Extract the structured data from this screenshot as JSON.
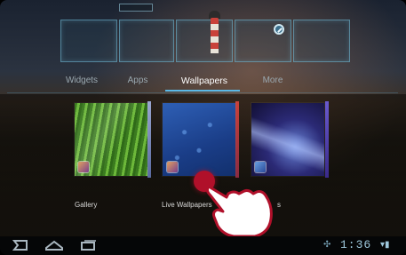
{
  "tabs": [
    {
      "label": "Widgets",
      "selected": false
    },
    {
      "label": "Apps",
      "selected": false
    },
    {
      "label": "Wallpapers",
      "selected": true
    },
    {
      "label": "More",
      "selected": false
    }
  ],
  "wallpapers": [
    {
      "label": "Gallery",
      "icon": "gallery-icon"
    },
    {
      "label": "Live Wallpapers",
      "icon": "live-wallpapers-icon"
    },
    {
      "label": "s",
      "icon": "wallpapers-icon"
    }
  ],
  "status_bar": {
    "time": "1:36",
    "icons": [
      "usb-icon",
      "wifi-icon",
      "battery-icon"
    ]
  },
  "nav": [
    "back-icon",
    "home-icon",
    "recent-apps-icon"
  ],
  "colors": {
    "accent": "#5ab8e6",
    "touch_indicator": "#b0102a"
  }
}
